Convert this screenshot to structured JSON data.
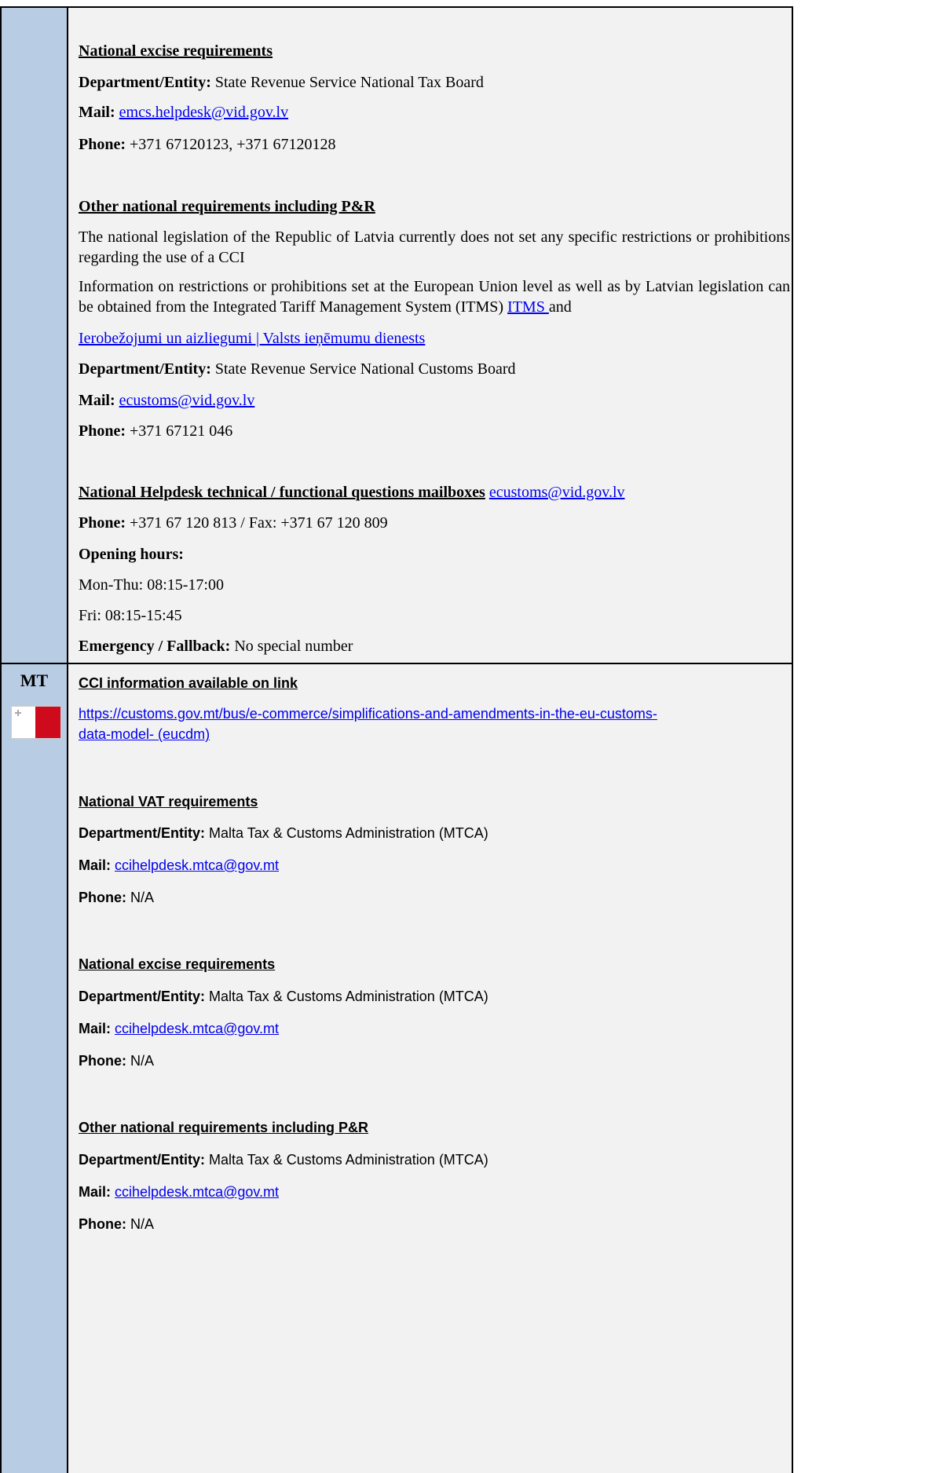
{
  "lv": {
    "excise_heading": "National excise requirements",
    "excise_dept_label": "Department/Entity:",
    "excise_dept_value": "State Revenue Service National Tax Board",
    "excise_mail_label": "Mail:",
    "excise_mail_link": "emcs.helpdesk@vid.gov.lv",
    "excise_phone_label": "Phone:",
    "excise_phone_value": "+371 67120123, +371 67120128",
    "other_heading": "Other national requirements including P&R",
    "other_para1": "The national legislation of the Republic of Latvia currently does not set any specific restrictions or prohibitions regarding the use of a CCI",
    "other_para2_text": "Information on restrictions or prohibitions set at the European Union level as well as by Latvian legislation can be obtained from the Integrated Tariff Management System (ITMS)",
    "other_para2_link": "ITMS ",
    "other_para2_tail": "and",
    "other_link2": "Ierobežojumi un aizliegumi | Valsts ieņēmumu dienests",
    "other_dept_label": "Department/Entity:",
    "other_dept_value": "State Revenue Service National Customs Board",
    "other_mail_label": "Mail:",
    "other_mail_link": "ecustoms@vid.gov.lv",
    "other_phone_label": "Phone:",
    "other_phone_value": "+371 67121 046",
    "helpdesk_heading": "National Helpdesk technical / functional questions mailboxes",
    "helpdesk_link": "ecustoms@vid.gov.lv",
    "helpdesk_phone_label": "Phone:",
    "helpdesk_phone_value": "+371 67 120 813 / Fax: +371 67 120 809",
    "opening_hours_label": "Opening hours:",
    "hours_mon_thu": "Mon-Thu:  08:15-17:00",
    "hours_fri": "Fri:  08:15-15:45",
    "emergency_label": "Emergency / Fallback:",
    "emergency_value": "No special number"
  },
  "mt": {
    "country_code": "MT",
    "cci_heading": "CCI information available on link",
    "cci_link_line1": "https://customs.gov.mt/bus/e-commerce/simplifications-and-amendments-in-the-eu-customs-",
    "cci_link_line2": "data-model- (eucdm)",
    "vat_heading": "National VAT requirements",
    "vat_dept_label": "Department/Entity:",
    "vat_dept_value": "Malta Tax & Customs Administration (MTCA)",
    "vat_mail_label": "Mail:",
    "vat_mail_link": "ccihelpdesk.mtca@gov.mt",
    "vat_phone_label": "Phone:",
    "vat_phone_value": "N/A",
    "excise_heading": "National excise requirements",
    "excise_dept_label": "Department/Entity:",
    "excise_dept_value": "Malta Tax & Customs Administration (MTCA)",
    "excise_mail_label": "Mail:",
    "excise_mail_link": "ccihelpdesk.mtca@gov.mt",
    "excise_phone_label": "Phone:",
    "excise_phone_value": "N/A",
    "other_heading": "Other national requirements including P&R",
    "other_dept_label": "Department/Entity:",
    "other_dept_value": "Malta Tax & Customs Administration (MTCA)",
    "other_mail_label": "Mail:",
    "other_mail_link": "ccihelpdesk.mtca@gov.mt",
    "other_phone_label": "Phone:",
    "other_phone_value": " N/A"
  },
  "colors": {
    "country_column": "#b8cce4",
    "content_background": "#f2f2f2",
    "link": "#0000ee",
    "flag_red": "#cf0a1c"
  }
}
